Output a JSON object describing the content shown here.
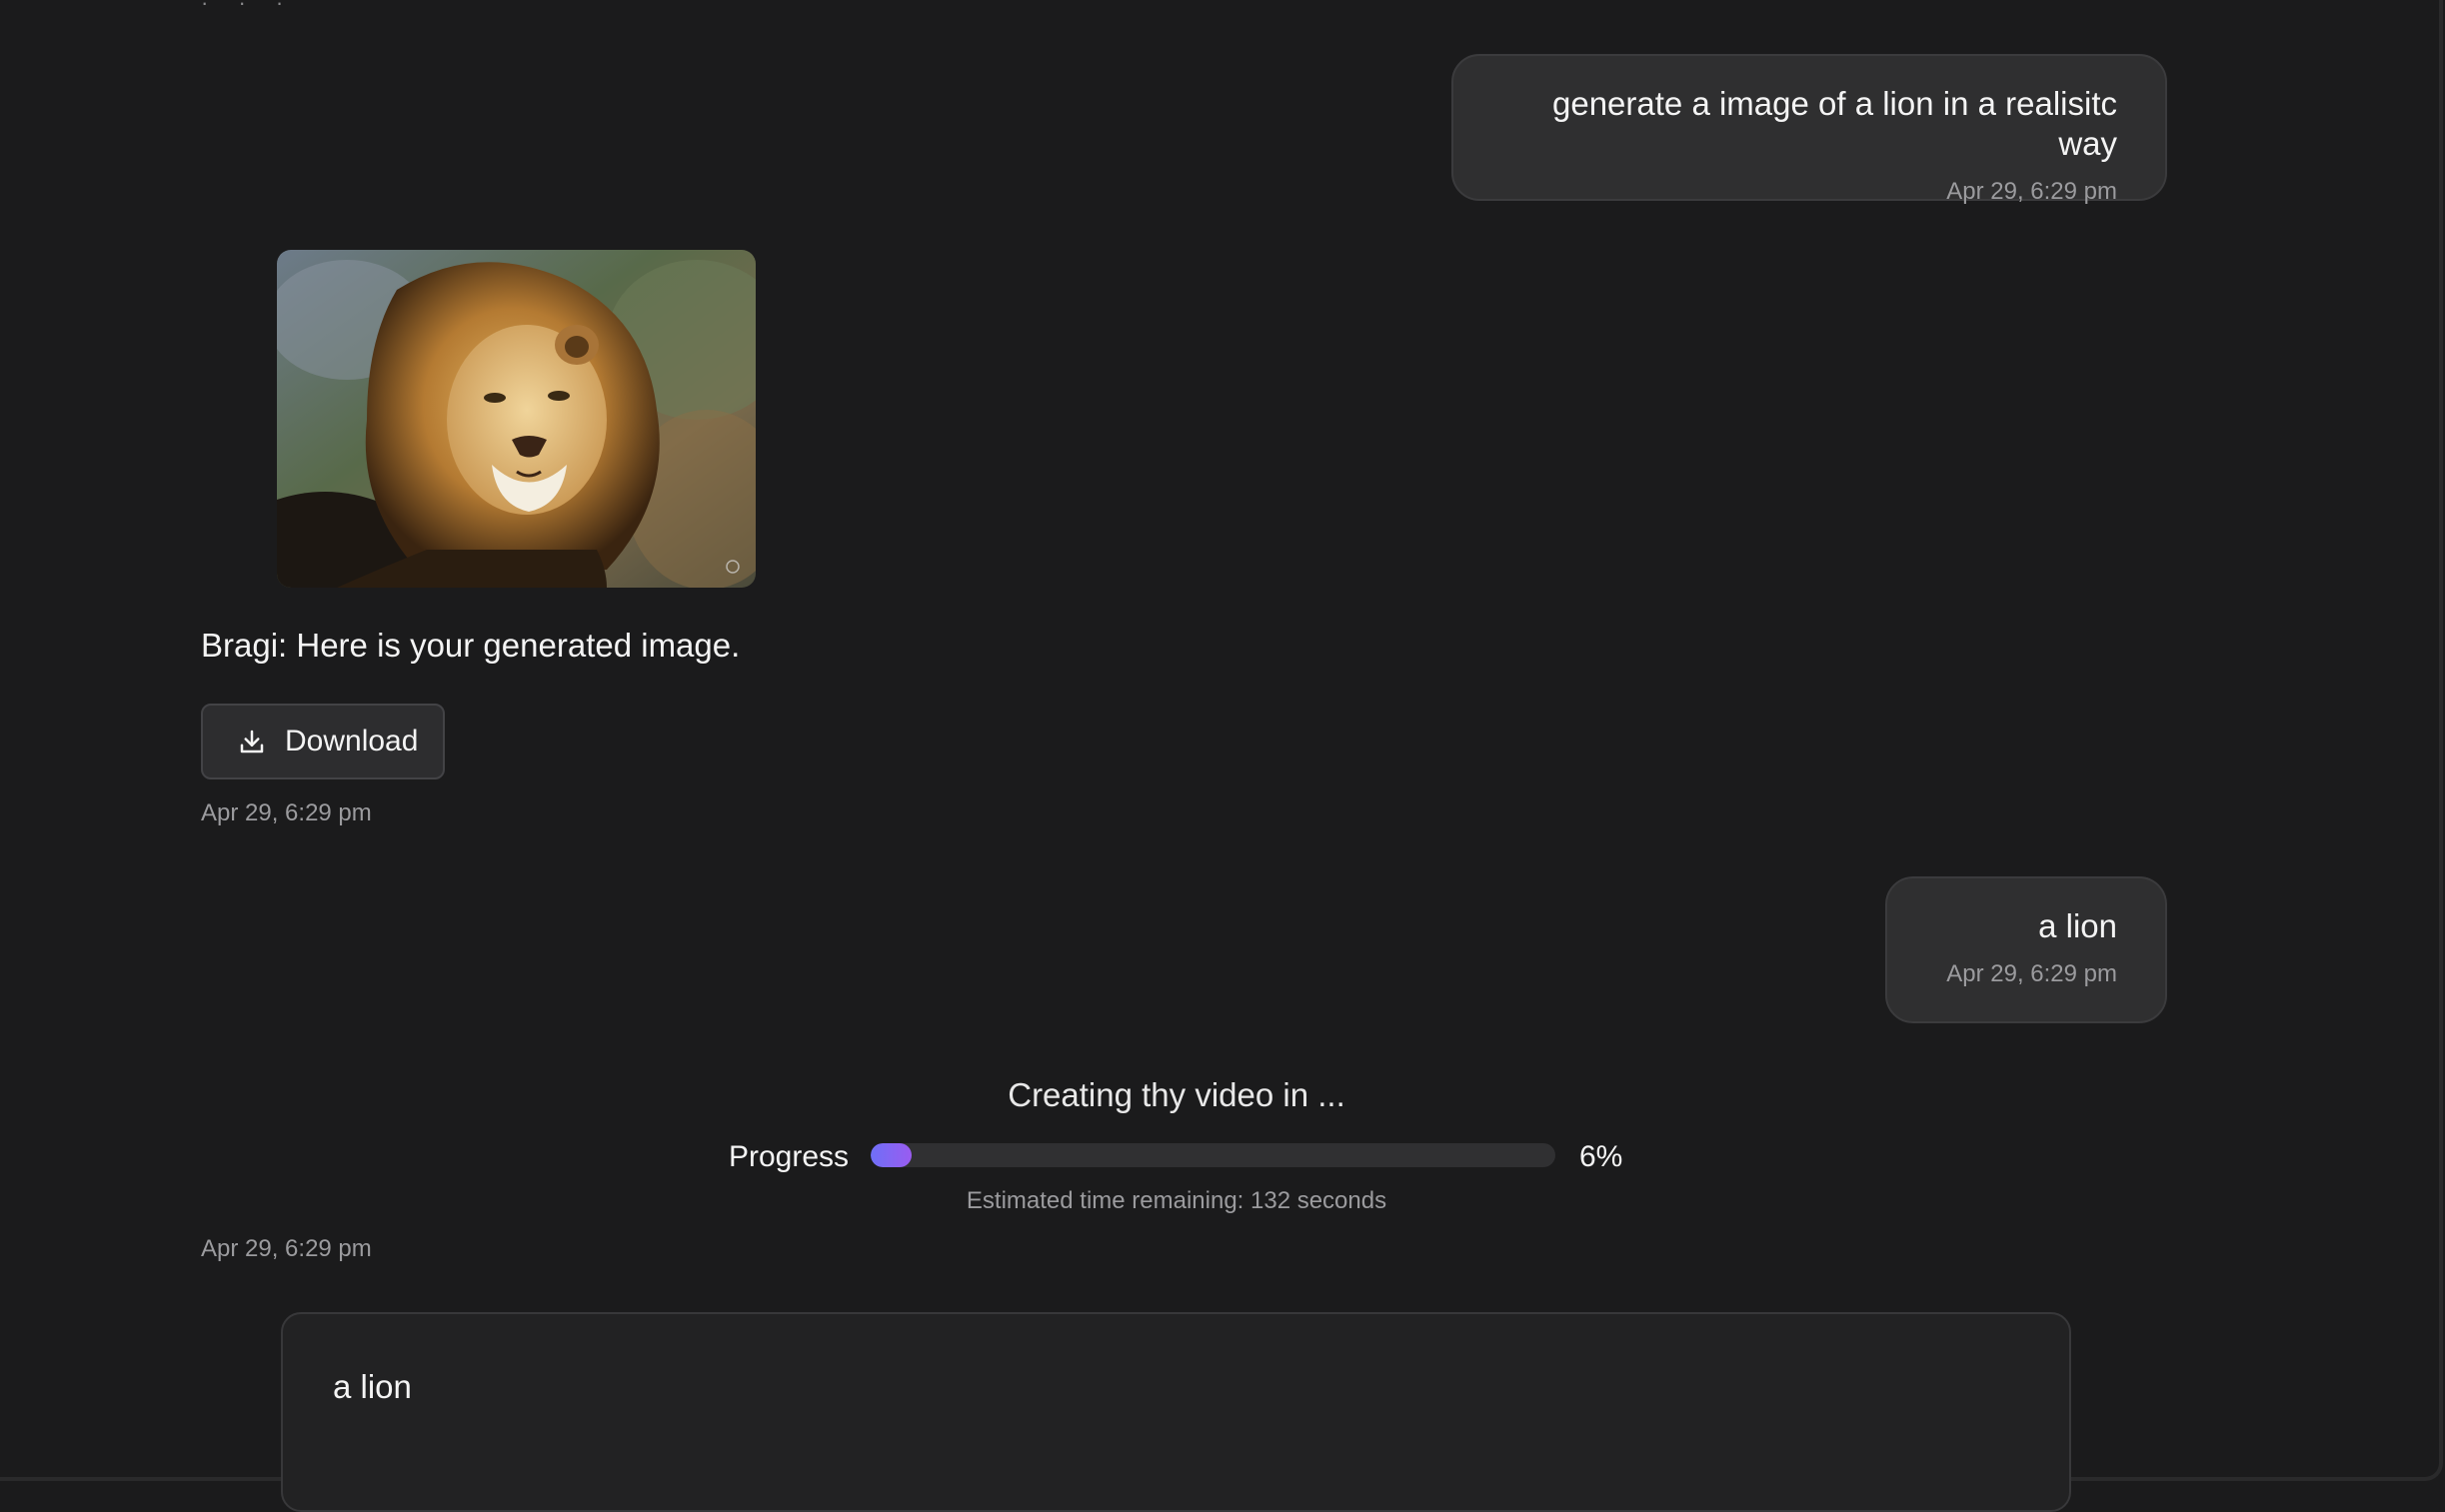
{
  "conversation": {
    "user_message_1": {
      "text": "generate a image of a lion in a realisitc way",
      "timestamp": "Apr 29, 6:29 pm"
    },
    "bot_reply": {
      "image_alt": "lion",
      "text": "Bragi: Here is your generated image.",
      "download_label": "Download",
      "timestamp": "Apr 29, 6:29 pm"
    },
    "user_message_2": {
      "text": "a lion",
      "timestamp": "Apr 29, 6:29 pm"
    },
    "video_progress": {
      "title": "Creating thy video in ...",
      "label": "Progress",
      "percent_text": "6%",
      "percent": 6,
      "eta": "Estimated time remaining: 132 seconds",
      "timestamp": "Apr 29, 6:29 pm",
      "fill_color_start": "#6f6ff7",
      "fill_color_end": "#9a5cf0"
    }
  },
  "composer": {
    "value": "a lion"
  },
  "icons": {
    "download": "download-icon",
    "image_corner": "sparkle-icon"
  },
  "colors": {
    "background": "#1b1b1c",
    "bubble": "#2f2f30",
    "muted_text": "#9b9b9e"
  }
}
